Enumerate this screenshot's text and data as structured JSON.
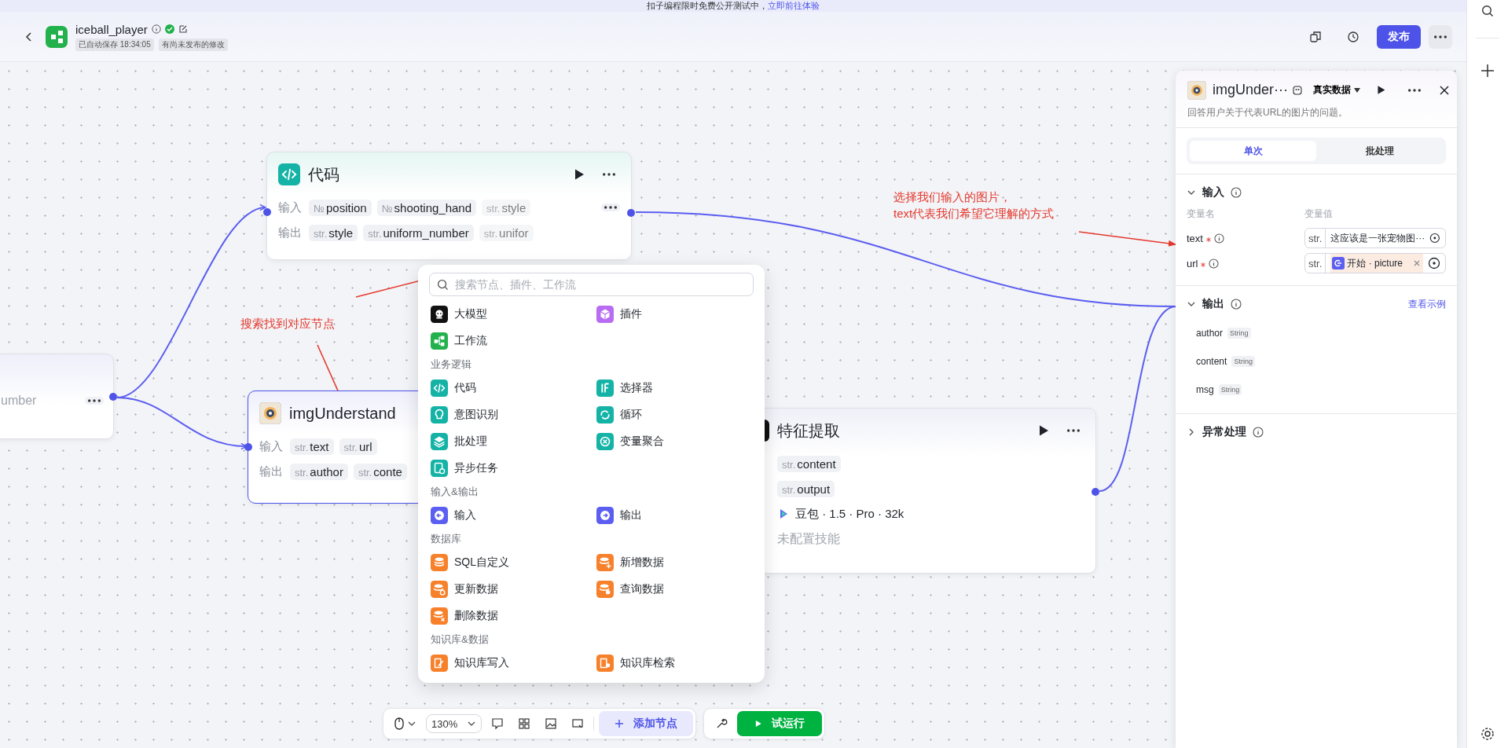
{
  "banner": {
    "text": "扣子编程限时免费公开测试中，",
    "link": "立即前往体验"
  },
  "header": {
    "app_name": "iceball_player",
    "saved": "已自动保存 18:34:05",
    "unpublished": "有尚未发布的修改",
    "publish": "发布"
  },
  "nodes": [
    {
      "kind": "fragment",
      "selected": false,
      "text": "umber"
    },
    {
      "kind": "code",
      "selected": false,
      "title": "代码",
      "inputs_label": "输入",
      "outputs_label": "输出",
      "inputs": [
        {
          "type": "№",
          "name": "position",
          "faded": false
        },
        {
          "type": "№",
          "name": "shooting_hand",
          "faded": false
        },
        {
          "type": "str.",
          "name": "style",
          "faded": true
        }
      ],
      "outputs": [
        {
          "type": "str.",
          "name": "style",
          "faded": false
        },
        {
          "type": "str.",
          "name": "uniform_number",
          "faded": false
        },
        {
          "type": "str.",
          "name": "unifor",
          "faded": true
        }
      ]
    },
    {
      "kind": "plugin",
      "selected": true,
      "title": "imgUnderstand",
      "inputs_label": "输入",
      "outputs_label": "输出",
      "inputs": [
        {
          "type": "str.",
          "name": "text",
          "faded": false
        },
        {
          "type": "str.",
          "name": "url",
          "faded": false
        }
      ],
      "outputs": [
        {
          "type": "str.",
          "name": "author",
          "faded": false
        },
        {
          "type": "str.",
          "name": "conte",
          "faded": false
        }
      ]
    },
    {
      "kind": "llm",
      "selected": false,
      "title": "特征提取",
      "inputs": [
        {
          "type": "str.",
          "name": "content",
          "faded": false
        }
      ],
      "outputs": [
        {
          "type": "str.",
          "name": "output",
          "faded": false
        }
      ],
      "model": "豆包 · 1.5 · Pro · 32k",
      "skills": "未配置技能"
    }
  ],
  "annotations": [
    {
      "text": "搜索找到对应节点"
    },
    {
      "text": "选择我们输入的图片，"
    },
    {
      "text": "text代表我们希望它理解的方式"
    }
  ],
  "node_menu": {
    "search_placeholder": "搜索节点、插件、工作流",
    "sections": [
      {
        "items": [
          {
            "label": "大模型",
            "color": "#111111"
          },
          {
            "label": "插件",
            "color": "#b86cf2"
          },
          {
            "label": "工作流",
            "color": "#22b14c"
          }
        ]
      },
      {
        "title": "业务逻辑",
        "items": [
          {
            "label": "代码",
            "color": "#14b3a6"
          },
          {
            "label": "选择器",
            "color": "#14b3a6"
          },
          {
            "label": "意图识别",
            "color": "#14b3a6"
          },
          {
            "label": "循环",
            "color": "#14b3a6"
          },
          {
            "label": "批处理",
            "color": "#14b3a6"
          },
          {
            "label": "变量聚合",
            "color": "#14b3a6"
          },
          {
            "label": "异步任务",
            "color": "#14b3a6"
          }
        ]
      },
      {
        "title": "输入&输出",
        "items": [
          {
            "label": "输入",
            "color": "#5b5ef0"
          },
          {
            "label": "输出",
            "color": "#5b5ef0"
          }
        ]
      },
      {
        "title": "数据库",
        "items": [
          {
            "label": "SQL自定义",
            "color": "#f7812b"
          },
          {
            "label": "新增数据",
            "color": "#f7812b"
          },
          {
            "label": "更新数据",
            "color": "#f7812b"
          },
          {
            "label": "查询数据",
            "color": "#f7812b"
          },
          {
            "label": "删除数据",
            "color": "#f7812b"
          }
        ]
      },
      {
        "title": "知识库&数据",
        "items": [
          {
            "label": "知识库写入",
            "color": "#f7812b"
          },
          {
            "label": "知识库检索",
            "color": "#f7812b"
          }
        ]
      }
    ]
  },
  "panel": {
    "title": "imgUnder···",
    "data_mode": "真实数据",
    "description": "回答用户关于代表URL的图片的问题。",
    "tabs": [
      {
        "label": "单次",
        "selected": true
      },
      {
        "label": "批处理",
        "selected": false
      }
    ],
    "input": {
      "title": "输入",
      "expanded": true,
      "name_header": "变量名",
      "value_header": "变量值",
      "params": [
        {
          "kind": "text",
          "name": "text",
          "required": true,
          "type": "str.",
          "value": "这应该是一张宠物图···"
        },
        {
          "kind": "reference",
          "name": "url",
          "required": true,
          "type": "str.",
          "value": "开始 · picture"
        }
      ]
    },
    "output": {
      "title": "输出",
      "expanded": true,
      "link": "查看示例",
      "fields": [
        {
          "name": "author",
          "type": "String"
        },
        {
          "name": "content",
          "type": "String"
        },
        {
          "name": "msg",
          "type": "String"
        }
      ]
    },
    "error": {
      "title": "异常处理",
      "expanded": false
    }
  },
  "toolbar": {
    "zoom": "130%",
    "add_node": "添加节点",
    "test_run": "试运行"
  }
}
